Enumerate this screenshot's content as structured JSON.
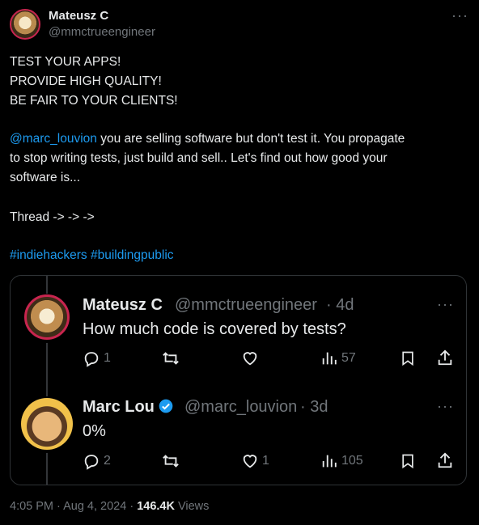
{
  "tweet": {
    "author": {
      "name": "Mateusz C",
      "handle": "@mmctrueengineer"
    },
    "more_label": "···",
    "lines": {
      "l1": "TEST YOUR APPS!",
      "l2": "PROVIDE HIGH QUALITY!",
      "l3": "BE FAIR TO YOUR CLIENTS!",
      "mention": "@marc_louvion",
      "l4_rest": " you are selling software but don't test it. You propagate",
      "l5": "to stop writing tests, just build and sell.. Let's find out how good your",
      "l6": "software is...",
      "l7": "Thread -> -> ->",
      "hashtag1": "#indiehackers",
      "hashtag2": "#buildingpublic"
    },
    "timestamp": "4:05 PM · Aug 4, 2024 · ",
    "views_count": "146.4K",
    "views_label": " Views"
  },
  "quote": {
    "reply1": {
      "name": "Mateusz C",
      "handle": "@mmctrueengineer",
      "age": "· 4d",
      "text": "How much code is covered by tests?",
      "reply_count": "1",
      "retweet_count": "",
      "like_count": "",
      "views": "57"
    },
    "reply2": {
      "name": "Marc Lou",
      "handle": "@marc_louvion",
      "age": "· 3d",
      "text": "0%",
      "reply_count": "2",
      "retweet_count": "",
      "like_count": "1",
      "views": "105"
    }
  },
  "icons": {
    "reply": "reply-icon",
    "retweet": "retweet-icon",
    "like": "heart-icon",
    "views": "views-icon",
    "bookmark": "bookmark-icon",
    "share": "share-icon",
    "verified": "verified-badge-icon"
  },
  "colors": {
    "background": "#000000",
    "text": "#e7e9ea",
    "muted": "#71767b",
    "link": "#1d9bf0",
    "border": "#2f3336"
  }
}
